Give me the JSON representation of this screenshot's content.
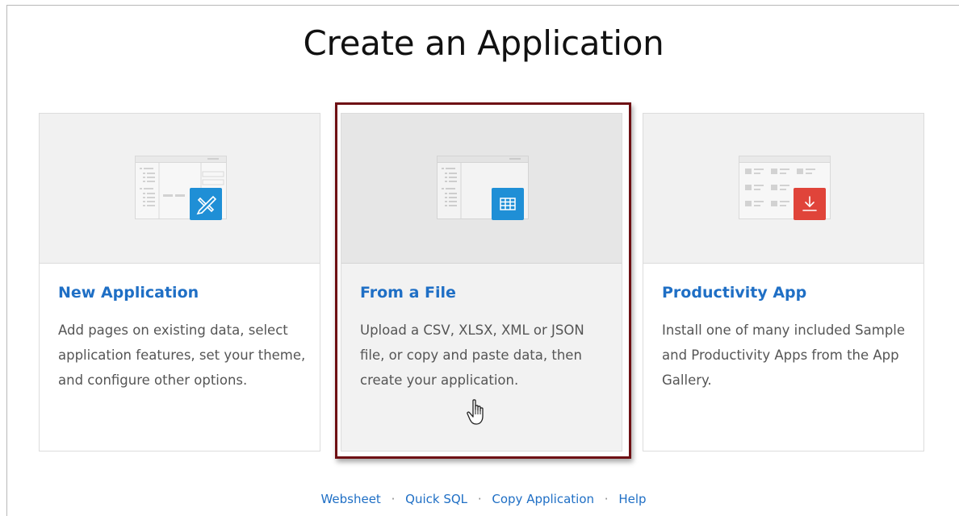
{
  "page": {
    "title": "Create an Application"
  },
  "cards": [
    {
      "heading": "New Application",
      "description": "Add pages on existing data, select application features, set your theme, and configure other options.",
      "icon": "pencil-ruler-icon",
      "badge_color": "#1f8fd6"
    },
    {
      "heading": "From a File",
      "description": "Upload a CSV, XLSX, XML or JSON file, or copy and paste data, then create your application.",
      "icon": "table-grid-icon",
      "badge_color": "#1f8fd6",
      "selected": true
    },
    {
      "heading": "Productivity App",
      "description": "Install one of many included Sample and Productivity Apps from the App Gallery.",
      "icon": "download-icon",
      "badge_color": "#e0443a"
    }
  ],
  "footer": {
    "links": [
      "Websheet",
      "Quick SQL",
      "Copy Application",
      "Help"
    ],
    "separator": "·"
  },
  "colors": {
    "link": "#1f6fc5",
    "selection_frame": "#6e1014"
  }
}
